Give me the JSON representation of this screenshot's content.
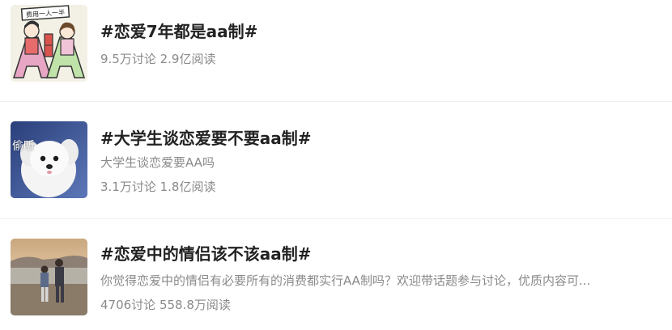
{
  "topics": [
    {
      "title": "#恋爱7年都是aa制#",
      "stats": "9.5万讨论 2.9亿阅读",
      "thumb_icon": "couple-cartoon-thumbnail",
      "thumb_text": "费用一人一半"
    },
    {
      "title": "#大学生谈恋爱要不要aa制#",
      "desc": "大学生谈恋爱要AA吗",
      "stats": "3.1万讨论 1.8亿阅读",
      "thumb_icon": "puppy-thumbnail",
      "badge": "偷听"
    },
    {
      "title": "#恋爱中的情侣该不该aa制#",
      "desc": "你觉得恋爱中的情侣有必要所有的消费都实行AA制吗？欢迎带话题参与讨论，优质内容可...",
      "stats": "4706讨论 558.8万阅读",
      "thumb_icon": "beach-couple-thumbnail"
    }
  ]
}
